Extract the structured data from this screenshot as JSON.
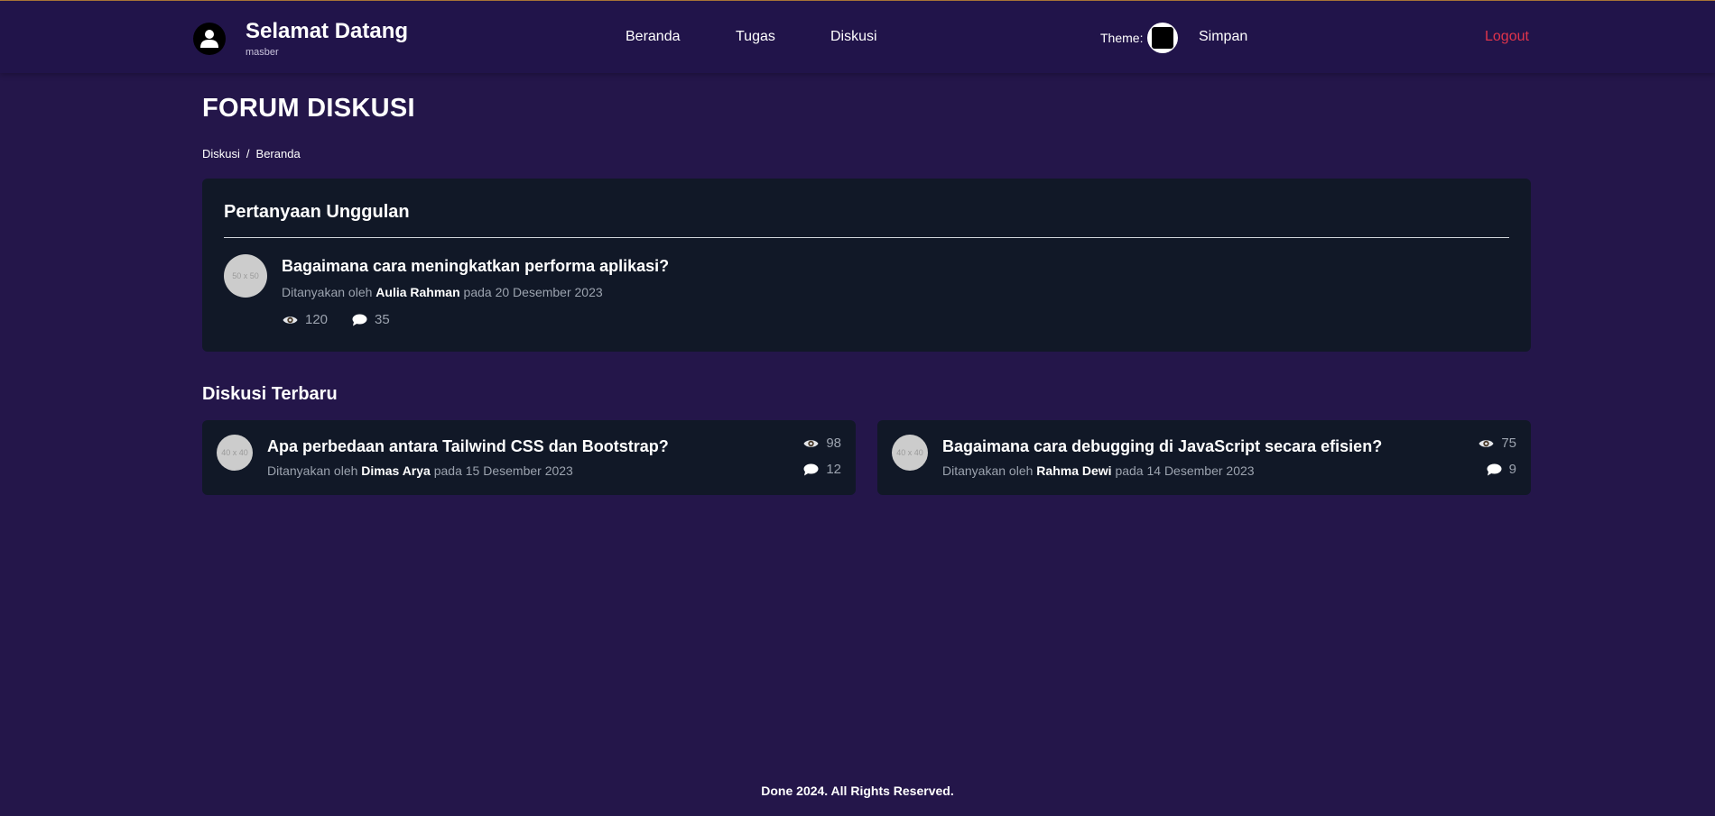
{
  "header": {
    "welcome": "Selamat Datang",
    "username": "masber",
    "nav": [
      "Beranda",
      "Tugas",
      "Diskusi"
    ],
    "theme_label": "Theme:",
    "save_label": "Simpan",
    "logout_label": "Logout"
  },
  "page": {
    "title": "FORUM DISKUSI",
    "breadcrumb": [
      "Diskusi",
      "/",
      "Beranda"
    ]
  },
  "featured": {
    "heading": "Pertanyaan Unggulan",
    "avatar_placeholder": "50 x 50",
    "title": "Bagaimana cara meningkatkan performa aplikasi?",
    "meta_prefix": "Ditanyakan oleh",
    "author": "Aulia Rahman",
    "meta_middle": "pada",
    "date": "20 Desember 2023",
    "views": "120",
    "comments": "35"
  },
  "recent": {
    "heading": "Diskusi Terbaru",
    "items": [
      {
        "avatar_placeholder": "40 x 40",
        "title": "Apa perbedaan antara Tailwind CSS dan Bootstrap?",
        "meta_prefix": "Ditanyakan oleh",
        "author": "Dimas Arya",
        "meta_middle": "pada",
        "date": "15 Desember 2023",
        "views": "98",
        "comments": "12"
      },
      {
        "avatar_placeholder": "40 x 40",
        "title": "Bagaimana cara debugging di JavaScript secara efisien?",
        "meta_prefix": "Ditanyakan oleh",
        "author": "Rahma Dewi",
        "meta_middle": "pada",
        "date": "14 Desember 2023",
        "views": "75",
        "comments": "9"
      }
    ]
  },
  "footer": {
    "text": "Done 2024. All Rights Reserved."
  },
  "colors": {
    "background": "#24164a",
    "card": "#111827",
    "logout": "#e0344b",
    "muted_text": "#9ca3af"
  },
  "icons": [
    "user-icon",
    "eye-icon",
    "comment-icon"
  ]
}
